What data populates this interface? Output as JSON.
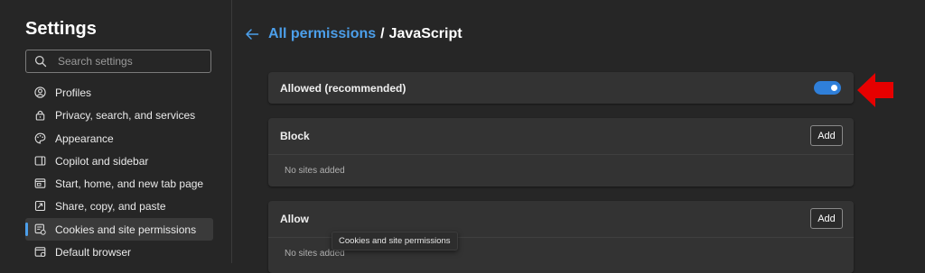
{
  "sidebar": {
    "title": "Settings",
    "search": {
      "placeholder": "Search settings",
      "value": ""
    },
    "items": [
      {
        "label": "Profiles",
        "icon": "profile-icon",
        "active": false
      },
      {
        "label": "Privacy, search, and services",
        "icon": "lock-icon",
        "active": false
      },
      {
        "label": "Appearance",
        "icon": "palette-icon",
        "active": false
      },
      {
        "label": "Copilot and sidebar",
        "icon": "sidebar-icon",
        "active": false
      },
      {
        "label": "Start, home, and new tab page",
        "icon": "home-tab-icon",
        "active": false
      },
      {
        "label": "Share, copy, and paste",
        "icon": "share-icon",
        "active": false
      },
      {
        "label": "Cookies and site permissions",
        "icon": "cookie-permissions-icon",
        "active": true
      },
      {
        "label": "Default browser",
        "icon": "browser-icon",
        "active": false
      }
    ]
  },
  "main": {
    "breadcrumb": {
      "parent": "All permissions",
      "separator": "/",
      "current": "JavaScript"
    },
    "allowed": {
      "label": "Allowed (recommended)",
      "toggle_on": true
    },
    "block": {
      "title": "Block",
      "add_label": "Add",
      "empty_text": "No sites added"
    },
    "allow": {
      "title": "Allow",
      "add_label": "Add",
      "empty_text": "No sites added"
    }
  },
  "tooltip": {
    "text": "Cookies and site permissions"
  },
  "colors": {
    "background": "#262626",
    "card": "#333333",
    "accent": "#4c9fea",
    "toggle": "#2f7fd9",
    "annotation_arrow": "#e60000"
  }
}
